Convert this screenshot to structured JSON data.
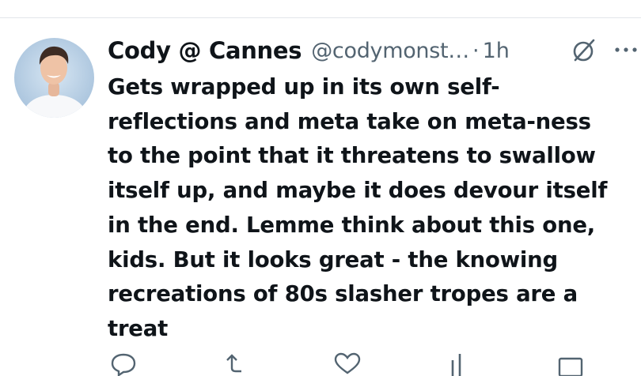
{
  "tweet": {
    "author_name": "Cody @ Cannes",
    "handle": "@codymonst…",
    "separator": "·",
    "time": "1h",
    "text": "Gets wrapped up in its own self-\nreflections and meta take on meta-ness\nto the point that it threatens to swallow\nitself up, and maybe it does devour itself\nin the end. Lemme think about this one,\nkids. But it looks great - the knowing\nrecreations of 80s slasher tropes are a\ntreat"
  },
  "icons": {
    "avatar": "profile-photo",
    "hide": "circle-slash-icon",
    "more": "more-dots-icon",
    "reply": "reply-icon",
    "retweet": "retweet-icon",
    "like": "heart-icon",
    "views": "views-bar-icon",
    "share": "share-icon"
  },
  "colors": {
    "text": "#0f1419",
    "muted": "#536471",
    "divider": "#e3e6ea"
  }
}
